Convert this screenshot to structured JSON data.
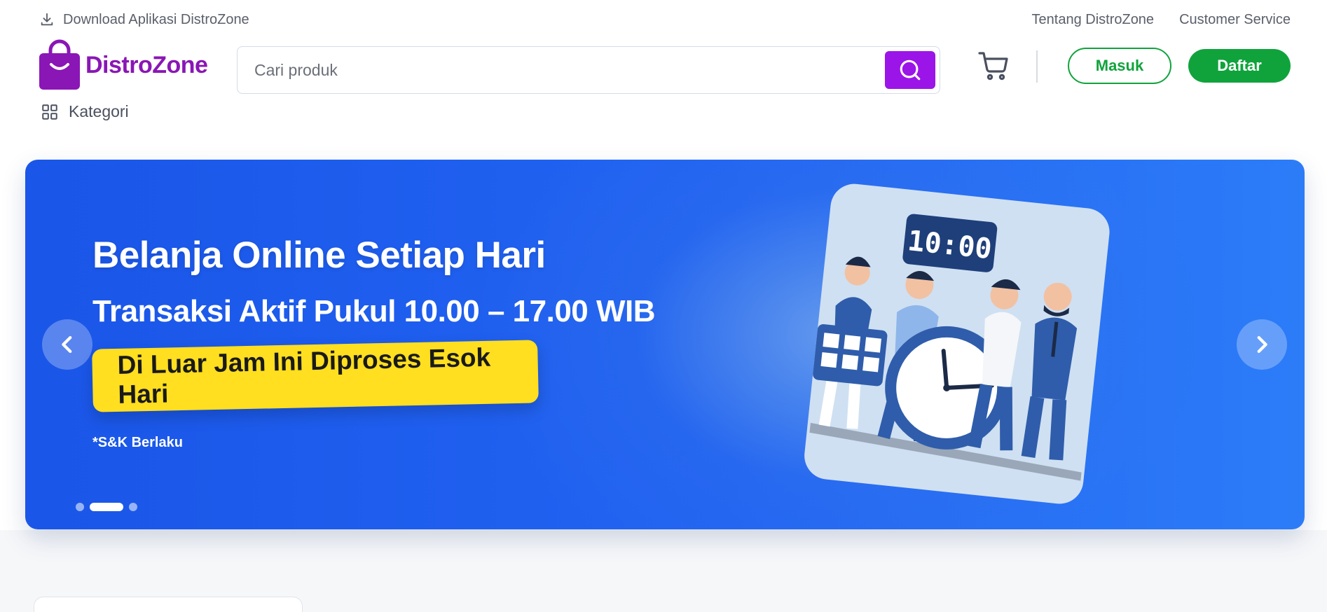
{
  "topbar": {
    "download_label": "Download Aplikasi DistroZone",
    "links": [
      "Tentang DistroZone",
      "Customer Service"
    ]
  },
  "brand": {
    "name": "DistroZone",
    "color": "#8a16b5"
  },
  "search": {
    "placeholder": "Cari produk",
    "button_color": "#9b15e8"
  },
  "auth": {
    "login_label": "Masuk",
    "register_label": "Daftar",
    "color": "#10a33c"
  },
  "nav": {
    "category_label": "Kategori"
  },
  "banner": {
    "title": "Belanja Online Setiap Hari",
    "subtitle": "Transaksi Aktif Pukul 10.00 – 17.00 WIB",
    "badge": "Di Luar Jam Ini Diproses Esok Hari",
    "note": "*S&K Berlaku",
    "clock_label": "10:00",
    "slide_count": 3,
    "active_slide": 2,
    "badge_color": "#ffdf1f"
  },
  "icons": [
    "download-icon",
    "logo-bag-icon",
    "search-icon",
    "cart-icon",
    "grid-icon",
    "chevron-left-icon",
    "chevron-right-icon"
  ]
}
